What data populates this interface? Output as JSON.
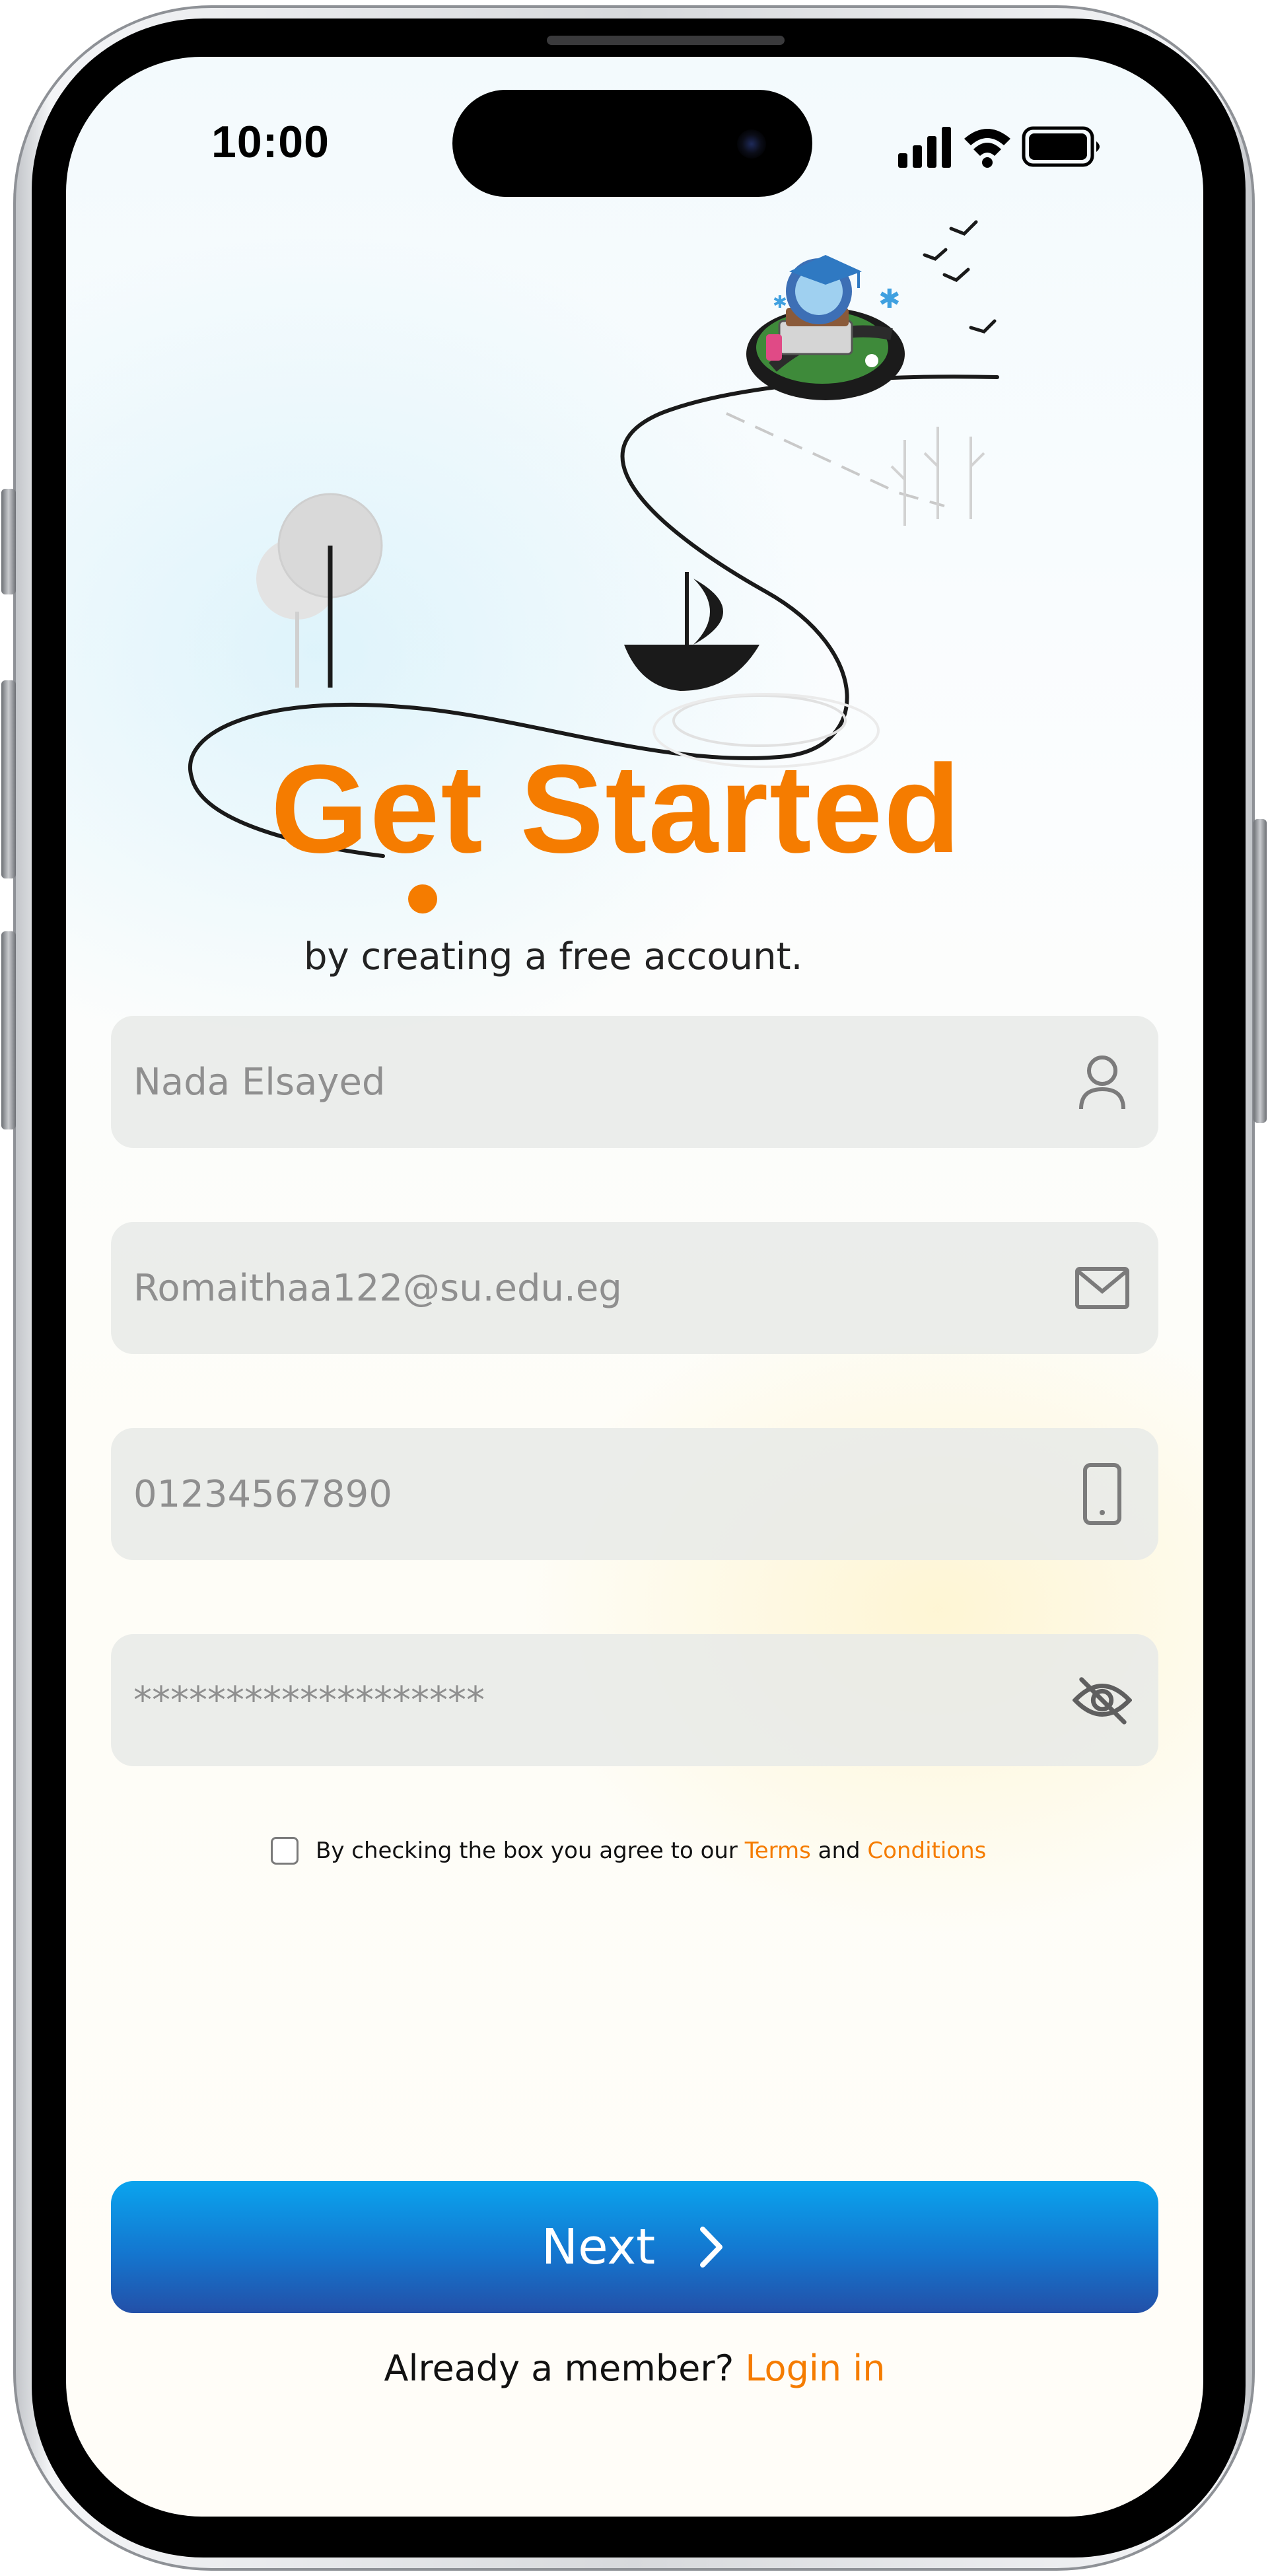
{
  "status_bar": {
    "time": "10:00",
    "icons": [
      "signal-icon",
      "wifi-icon",
      "battery-icon"
    ]
  },
  "header": {
    "title": "Get Started",
    "subtitle": "by creating a free account."
  },
  "form": {
    "fields": [
      {
        "name": "full-name-field",
        "value": "Nada Elsayed",
        "icon": "user-icon"
      },
      {
        "name": "email-field",
        "value": "Romaithaa122@su.edu.eg",
        "icon": "mail-icon"
      },
      {
        "name": "phone-field",
        "value": "01234567890",
        "icon": "phone-icon"
      },
      {
        "name": "password-field",
        "value": "*******************",
        "icon": "eye-off-icon"
      }
    ],
    "terms": {
      "prefix": "By checking the box you agree to our ",
      "terms_link": "Terms",
      "middle": " and ",
      "conditions_link": "Conditions",
      "checked": false
    }
  },
  "actions": {
    "next_label": "Next",
    "login_prompt": "Already a member?",
    "login_link": "Login in"
  },
  "colors": {
    "accent": "#f57c00",
    "button_top": "#0aa4ee",
    "button_bottom": "#2350a8",
    "field_bg": "#e8eae8"
  }
}
